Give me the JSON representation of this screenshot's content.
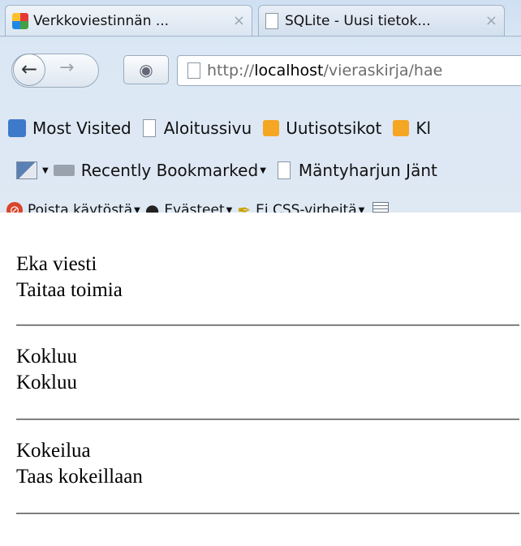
{
  "tabs": [
    {
      "title": "Verkkoviestinnän ...",
      "close": "×"
    },
    {
      "title": "SQLite - Uusi tietok...",
      "close": "×"
    }
  ],
  "nav": {
    "back": "←",
    "forward": "→",
    "url_scheme": "http://",
    "url_host": "localhost",
    "url_path": "/vieraskirja/hae"
  },
  "bookmarks": {
    "most_visited": "Most Visited",
    "aloitussivu": "Aloitussivu",
    "uutisotsikot": "Uutisotsikot",
    "truncated": "Kl",
    "recently_bookmarked": "Recently Bookmarked",
    "mantyharjun": "Mäntyharjun Jänt"
  },
  "devtoolbar": {
    "poista": "Poista käytöstä",
    "evasteet": "Evästeet",
    "css": "Ei CSS-virheitä"
  },
  "posts": [
    {
      "title": "Eka viesti",
      "body": "Taitaa toimia"
    },
    {
      "title": "Kokluu",
      "body": "Kokluu"
    },
    {
      "title": "Kokeilua",
      "body": "Taas kokeillaan"
    }
  ]
}
